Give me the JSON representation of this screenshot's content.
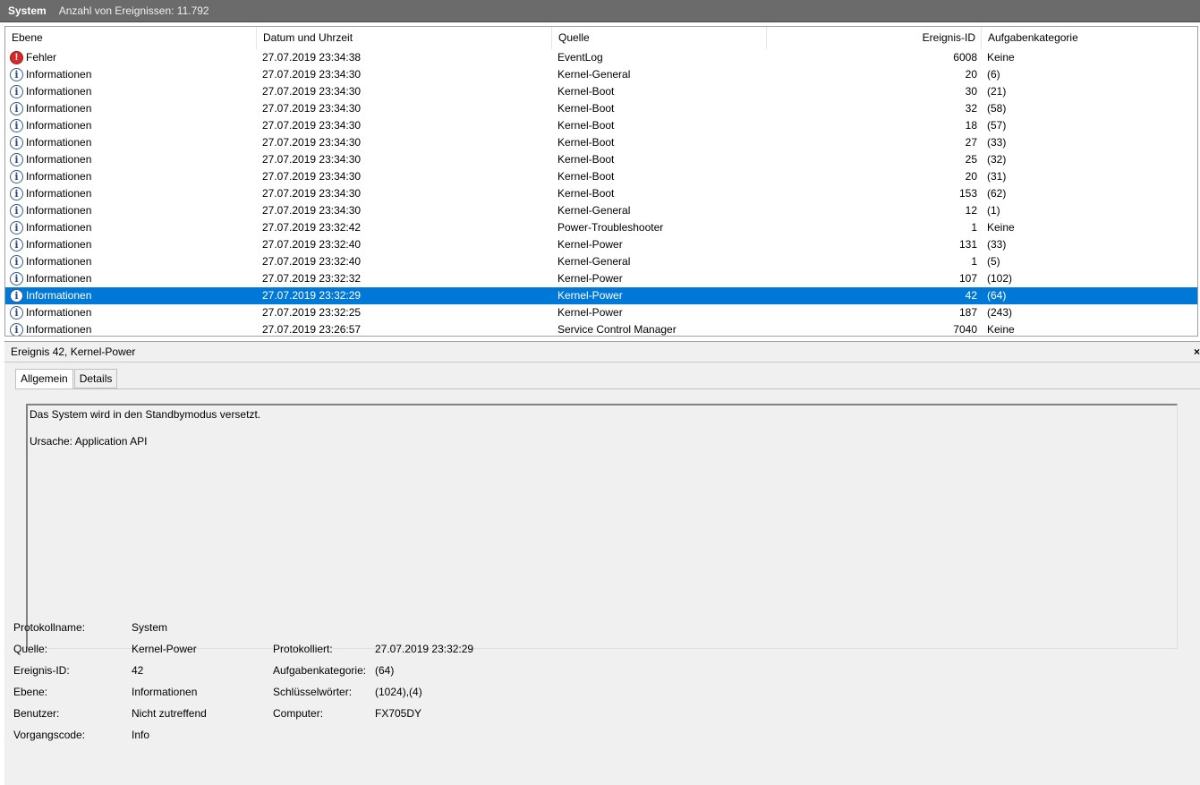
{
  "title": {
    "log_name": "System",
    "count_text": "Anzahl von Ereignissen: 11.792"
  },
  "columns": {
    "level": "Ebene",
    "date": "Datum und Uhrzeit",
    "source": "Quelle",
    "event_id": "Ereignis-ID",
    "category": "Aufgabenkategorie"
  },
  "events": [
    {
      "icon": "error-icon",
      "level": "Fehler",
      "date": "27.07.2019 23:34:38",
      "source": "EventLog",
      "id": "6008",
      "category": "Keine",
      "selected": false
    },
    {
      "icon": "info-icon",
      "level": "Informationen",
      "date": "27.07.2019 23:34:30",
      "source": "Kernel-General",
      "id": "20",
      "category": "(6)",
      "selected": false
    },
    {
      "icon": "info-icon",
      "level": "Informationen",
      "date": "27.07.2019 23:34:30",
      "source": "Kernel-Boot",
      "id": "30",
      "category": "(21)",
      "selected": false
    },
    {
      "icon": "info-icon",
      "level": "Informationen",
      "date": "27.07.2019 23:34:30",
      "source": "Kernel-Boot",
      "id": "32",
      "category": "(58)",
      "selected": false
    },
    {
      "icon": "info-icon",
      "level": "Informationen",
      "date": "27.07.2019 23:34:30",
      "source": "Kernel-Boot",
      "id": "18",
      "category": "(57)",
      "selected": false
    },
    {
      "icon": "info-icon",
      "level": "Informationen",
      "date": "27.07.2019 23:34:30",
      "source": "Kernel-Boot",
      "id": "27",
      "category": "(33)",
      "selected": false
    },
    {
      "icon": "info-icon",
      "level": "Informationen",
      "date": "27.07.2019 23:34:30",
      "source": "Kernel-Boot",
      "id": "25",
      "category": "(32)",
      "selected": false
    },
    {
      "icon": "info-icon",
      "level": "Informationen",
      "date": "27.07.2019 23:34:30",
      "source": "Kernel-Boot",
      "id": "20",
      "category": "(31)",
      "selected": false
    },
    {
      "icon": "info-icon",
      "level": "Informationen",
      "date": "27.07.2019 23:34:30",
      "source": "Kernel-Boot",
      "id": "153",
      "category": "(62)",
      "selected": false
    },
    {
      "icon": "info-icon",
      "level": "Informationen",
      "date": "27.07.2019 23:34:30",
      "source": "Kernel-General",
      "id": "12",
      "category": "(1)",
      "selected": false
    },
    {
      "icon": "info-icon",
      "level": "Informationen",
      "date": "27.07.2019 23:32:42",
      "source": "Power-Troubleshooter",
      "id": "1",
      "category": "Keine",
      "selected": false
    },
    {
      "icon": "info-icon",
      "level": "Informationen",
      "date": "27.07.2019 23:32:40",
      "source": "Kernel-Power",
      "id": "131",
      "category": "(33)",
      "selected": false
    },
    {
      "icon": "info-icon",
      "level": "Informationen",
      "date": "27.07.2019 23:32:40",
      "source": "Kernel-General",
      "id": "1",
      "category": "(5)",
      "selected": false
    },
    {
      "icon": "info-icon",
      "level": "Informationen",
      "date": "27.07.2019 23:32:32",
      "source": "Kernel-Power",
      "id": "107",
      "category": "(102)",
      "selected": false
    },
    {
      "icon": "info-icon",
      "level": "Informationen",
      "date": "27.07.2019 23:32:29",
      "source": "Kernel-Power",
      "id": "42",
      "category": "(64)",
      "selected": true
    },
    {
      "icon": "info-icon",
      "level": "Informationen",
      "date": "27.07.2019 23:32:25",
      "source": "Kernel-Power",
      "id": "187",
      "category": "(243)",
      "selected": false
    },
    {
      "icon": "info-icon",
      "level": "Informationen",
      "date": "27.07.2019 23:26:57",
      "source": "Service Control Manager",
      "id": "7040",
      "category": "Keine",
      "selected": false
    }
  ],
  "detail": {
    "header": "Ereignis 42, Kernel-Power",
    "close_glyph": "×",
    "tabs": [
      "Allgemein",
      "Details"
    ],
    "message_line1": "Das System wird in den Standbymodus versetzt.",
    "message_line2": "Ursache: Application API",
    "properties": {
      "log_name_label": "Protokollname:",
      "log_name_value": "System",
      "source_label": "Quelle:",
      "source_value": "Kernel-Power",
      "logged_label": "Protokolliert:",
      "logged_value": "27.07.2019 23:32:29",
      "event_id_label": "Ereignis-ID:",
      "event_id_value": "42",
      "task_label": "Aufgabenkategorie:",
      "task_value": "(64)",
      "level_label": "Ebene:",
      "level_value": "Informationen",
      "keywords_label": "Schlüsselwörter:",
      "keywords_value": "(1024),(4)",
      "user_label": "Benutzer:",
      "user_value": "Nicht zutreffend",
      "computer_label": "Computer:",
      "computer_value": "FX705DY",
      "opcode_label": "Vorgangscode:",
      "opcode_value": "Info"
    }
  },
  "colors": {
    "selection": "#0078d7",
    "titlebar": "#6b6b6b",
    "error": "#d42a2a"
  }
}
